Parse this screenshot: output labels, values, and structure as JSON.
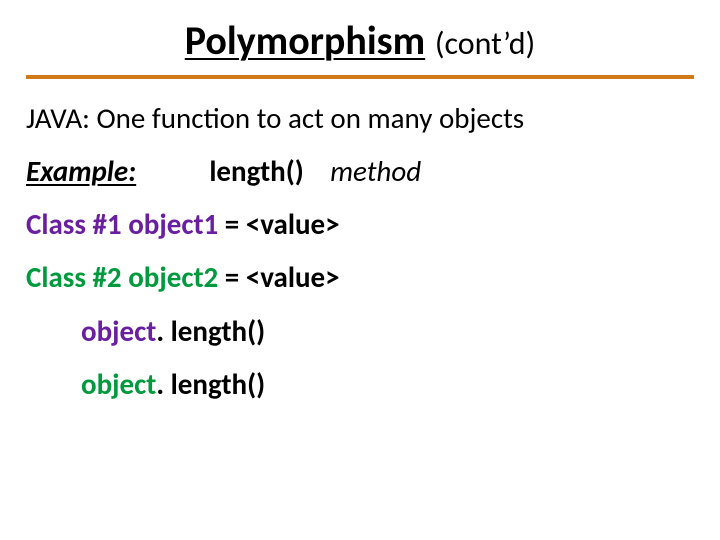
{
  "title": {
    "main": "Polymorphism",
    "sub": "(cont’d)"
  },
  "line1": "JAVA: One function to act on many objects",
  "example": {
    "label": "Example:",
    "method": "length()",
    "word": "method"
  },
  "decl1": {
    "classkw": "Class #1",
    "objname": "object1",
    "eq": " = ",
    "value": "<value>"
  },
  "decl2": {
    "classkw": "Class #2",
    "objname": "object2",
    "eq": " = ",
    "value": "<value>"
  },
  "call1": {
    "obj": "object",
    "dot": ". ",
    "rest": "length()"
  },
  "call2": {
    "obj": "object",
    "dot": ". ",
    "rest": "length()"
  }
}
